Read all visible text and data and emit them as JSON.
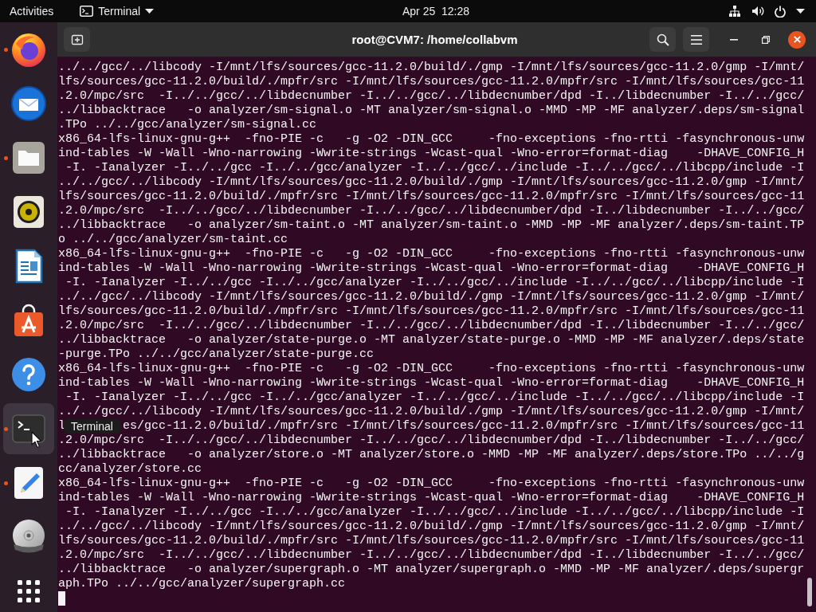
{
  "top_bar": {
    "activities": "Activities",
    "app_menu": "Terminal",
    "clock": "Apr 25  12:28"
  },
  "dock": {
    "items": [
      {
        "kind": "browser",
        "running": true,
        "selected": false
      },
      {
        "kind": "mail",
        "running": false,
        "selected": false
      },
      {
        "kind": "files",
        "running": true,
        "selected": false
      },
      {
        "kind": "music",
        "running": false,
        "selected": false
      },
      {
        "kind": "writer",
        "running": false,
        "selected": false
      },
      {
        "kind": "store",
        "running": false,
        "selected": false
      },
      {
        "kind": "help",
        "running": false,
        "selected": false
      },
      {
        "kind": "terminal",
        "running": true,
        "selected": true
      },
      {
        "kind": "editor",
        "running": true,
        "selected": false
      },
      {
        "kind": "disc",
        "running": false,
        "selected": false
      }
    ],
    "tooltip": "Terminal"
  },
  "window": {
    "title": "root@CVM7: /home/collabvm",
    "lines": [
      "../../gcc/../libcody -I/mnt/lfs/sources/gcc-11.2.0/build/./gmp -I/mnt/lfs/sources/gcc-11.2.0/gmp -I/mnt/",
      "lfs/sources/gcc-11.2.0/build/./mpfr/src -I/mnt/lfs/sources/gcc-11.2.0/mpfr/src -I/mnt/lfs/sources/gcc-11",
      ".2.0/mpc/src  -I../../gcc/../libdecnumber -I../../gcc/../libdecnumber/dpd -I../libdecnumber -I../../gcc/",
      "../libbacktrace   -o analyzer/sm-signal.o -MT analyzer/sm-signal.o -MMD -MP -MF analyzer/.deps/sm-signal",
      ".TPo ../../gcc/analyzer/sm-signal.cc",
      "x86_64-lfs-linux-gnu-g++  -fno-PIE -c   -g -O2 -DIN_GCC     -fno-exceptions -fno-rtti -fasynchronous-unw",
      "ind-tables -W -Wall -Wno-narrowing -Wwrite-strings -Wcast-qual -Wno-error=format-diag    -DHAVE_CONFIG_H",
      " -I. -Ianalyzer -I../../gcc -I../../gcc/analyzer -I../../gcc/../include -I../../gcc/../libcpp/include -I",
      "../../gcc/../libcody -I/mnt/lfs/sources/gcc-11.2.0/build/./gmp -I/mnt/lfs/sources/gcc-11.2.0/gmp -I/mnt/",
      "lfs/sources/gcc-11.2.0/build/./mpfr/src -I/mnt/lfs/sources/gcc-11.2.0/mpfr/src -I/mnt/lfs/sources/gcc-11",
      ".2.0/mpc/src  -I../../gcc/../libdecnumber -I../../gcc/../libdecnumber/dpd -I../libdecnumber -I../../gcc/",
      "../libbacktrace   -o analyzer/sm-taint.o -MT analyzer/sm-taint.o -MMD -MP -MF analyzer/.deps/sm-taint.TP",
      "o ../../gcc/analyzer/sm-taint.cc",
      "x86_64-lfs-linux-gnu-g++  -fno-PIE -c   -g -O2 -DIN_GCC     -fno-exceptions -fno-rtti -fasynchronous-unw",
      "ind-tables -W -Wall -Wno-narrowing -Wwrite-strings -Wcast-qual -Wno-error=format-diag    -DHAVE_CONFIG_H",
      " -I. -Ianalyzer -I../../gcc -I../../gcc/analyzer -I../../gcc/../include -I../../gcc/../libcpp/include -I",
      "../../gcc/../libcody -I/mnt/lfs/sources/gcc-11.2.0/build/./gmp -I/mnt/lfs/sources/gcc-11.2.0/gmp -I/mnt/",
      "lfs/sources/gcc-11.2.0/build/./mpfr/src -I/mnt/lfs/sources/gcc-11.2.0/mpfr/src -I/mnt/lfs/sources/gcc-11",
      ".2.0/mpc/src  -I../../gcc/../libdecnumber -I../../gcc/../libdecnumber/dpd -I../libdecnumber -I../../gcc/",
      "../libbacktrace   -o analyzer/state-purge.o -MT analyzer/state-purge.o -MMD -MP -MF analyzer/.deps/state",
      "-purge.TPo ../../gcc/analyzer/state-purge.cc",
      "x86_64-lfs-linux-gnu-g++  -fno-PIE -c   -g -O2 -DIN_GCC     -fno-exceptions -fno-rtti -fasynchronous-unw",
      "ind-tables -W -Wall -Wno-narrowing -Wwrite-strings -Wcast-qual -Wno-error=format-diag    -DHAVE_CONFIG_H",
      " -I. -Ianalyzer -I../../gcc -I../../gcc/analyzer -I../../gcc/../include -I../../gcc/../libcpp/include -I",
      "../../gcc/../libcody -I/mnt/lfs/sources/gcc-11.2.0/build/./gmp -I/mnt/lfs/sources/gcc-11.2.0/gmp -I/mnt/",
      "l        es/gcc-11.2.0/build/./mpfr/src -I/mnt/lfs/sources/gcc-11.2.0/mpfr/src -I/mnt/lfs/sources/gcc-11",
      ".2.0/mpc/src  -I../../gcc/../libdecnumber -I../../gcc/../libdecnumber/dpd -I../libdecnumber -I../../gcc/",
      "../libbacktrace   -o analyzer/store.o -MT analyzer/store.o -MMD -MP -MF analyzer/.deps/store.TPo ../../g",
      "cc/analyzer/store.cc",
      "x86_64-lfs-linux-gnu-g++  -fno-PIE -c   -g -O2 -DIN_GCC     -fno-exceptions -fno-rtti -fasynchronous-unw",
      "ind-tables -W -Wall -Wno-narrowing -Wwrite-strings -Wcast-qual -Wno-error=format-diag    -DHAVE_CONFIG_H",
      " -I. -Ianalyzer -I../../gcc -I../../gcc/analyzer -I../../gcc/../include -I../../gcc/../libcpp/include -I",
      "../../gcc/../libcody -I/mnt/lfs/sources/gcc-11.2.0/build/./gmp -I/mnt/lfs/sources/gcc-11.2.0/gmp -I/mnt/",
      "lfs/sources/gcc-11.2.0/build/./mpfr/src -I/mnt/lfs/sources/gcc-11.2.0/mpfr/src -I/mnt/lfs/sources/gcc-11",
      ".2.0/mpc/src  -I../../gcc/../libdecnumber -I../../gcc/../libdecnumber/dpd -I../libdecnumber -I../../gcc/",
      "../libbacktrace   -o analyzer/supergraph.o -MT analyzer/supergraph.o -MMD -MP -MF analyzer/.deps/supergr",
      "aph.TPo ../../gcc/analyzer/supergraph.cc"
    ]
  }
}
